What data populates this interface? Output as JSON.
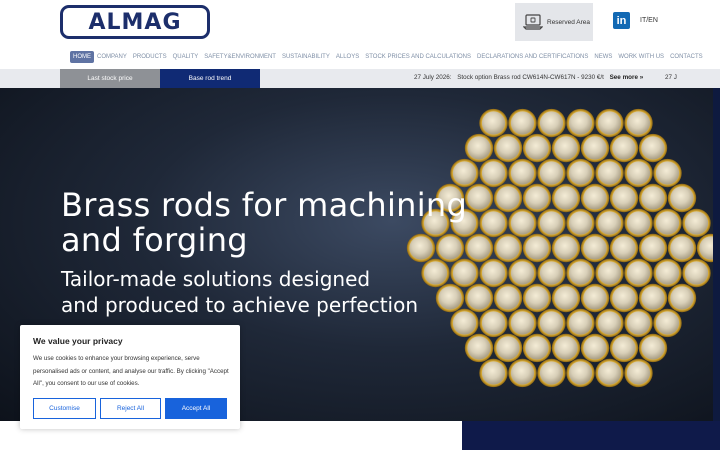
{
  "header": {
    "logo": "ALMAG",
    "reserved_area": "Reserved Area",
    "linkedin": "in",
    "language": "IT/EN"
  },
  "nav": {
    "items": [
      "HOME",
      "COMPANY",
      "PRODUCTS",
      "QUALITY",
      "SAFETY&ENVIRONMENT",
      "SUSTAINABILITY",
      "ALLOYS",
      "STOCK PRICES AND CALCULATIONS",
      "DECLARATIONS AND CERTIFICATIONS",
      "NEWS",
      "WORK WITH US",
      "CONTACTS"
    ],
    "active_index": 0
  },
  "ticker": {
    "tab_last": "Last stock price",
    "tab_base": "Base rod trend",
    "date": "27 July 2026:",
    "text": "Stock option Brass rod CW614N-CW617N - 9230 €/t",
    "see_more": "See more »",
    "date_next": "27 J"
  },
  "hero": {
    "title_line1": "Brass rods for machining",
    "title_line2": "and forging",
    "sub_line1": "Tailor-made solutions designed",
    "sub_line2": "and produced to achieve perfection"
  },
  "cookie": {
    "title": "We value your privacy",
    "text": "We use cookies to enhance your browsing experience, serve personalised ads or content, and analyse our traffic. By clicking \"Accept All\", you consent to our use of cookies.",
    "customise": "Customise",
    "reject": "Reject All",
    "accept": "Accept All"
  },
  "colors": {
    "brand_navy": "#1c2e6b",
    "nav_active": "#5f73a3",
    "cookie_blue": "#1863dc",
    "brass": "#d4a52c"
  },
  "icons": [
    "laptop-icon",
    "linkedin-icon",
    "brass-rod-icon"
  ]
}
